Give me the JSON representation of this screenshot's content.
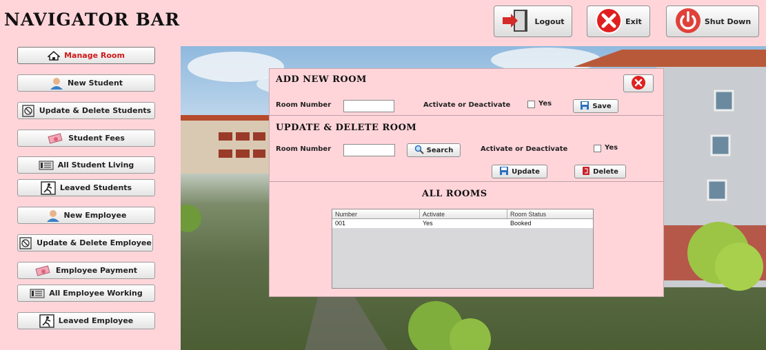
{
  "nav": {
    "title": "NAVIGATOR BAR",
    "items": [
      {
        "label": "Manage Room",
        "icon": "house-icon",
        "active": true
      },
      {
        "label": "New Student",
        "icon": "user-icon"
      },
      {
        "label": "Update & Delete Students",
        "icon": "edit-delete-icon"
      },
      {
        "label": "Student Fees",
        "icon": "money-icon"
      },
      {
        "label": "All Student Living",
        "icon": "list-icon"
      },
      {
        "label": "Leaved Students",
        "icon": "exit-person-icon"
      },
      {
        "label": "New Employee",
        "icon": "user-icon"
      },
      {
        "label": "Update & Delete Employee",
        "icon": "edit-delete-icon"
      },
      {
        "label": "Employee Payment",
        "icon": "money-icon"
      },
      {
        "label": "All Employee Working",
        "icon": "list-icon"
      },
      {
        "label": "Leaved Employee",
        "icon": "exit-person-icon"
      }
    ]
  },
  "top": {
    "logout": "Logout",
    "exit": "Exit",
    "shutdown": "Shut Down"
  },
  "add_room": {
    "title": "ADD NEW ROOM",
    "room_number_label": "Room Number",
    "room_number_value": "",
    "activate_label": "Activate or Deactivate",
    "yes_label": "Yes",
    "save_label": "Save"
  },
  "update_room": {
    "title": "UPDATE & DELETE ROOM",
    "room_number_label": "Room Number",
    "room_number_value": "",
    "search_label": "Search",
    "activate_label": "Activate or Deactivate",
    "yes_label": "Yes",
    "update_label": "Update",
    "delete_label": "Delete"
  },
  "all_rooms": {
    "title": "ALL ROOMS",
    "columns": [
      "Number",
      "Activate",
      "Room Status"
    ],
    "rows": [
      {
        "number": "001",
        "activate": "Yes",
        "status": "Booked"
      }
    ]
  },
  "colors": {
    "background": "#ffd5da",
    "active_nav_text": "#d01818",
    "close_button": "#e02020"
  }
}
